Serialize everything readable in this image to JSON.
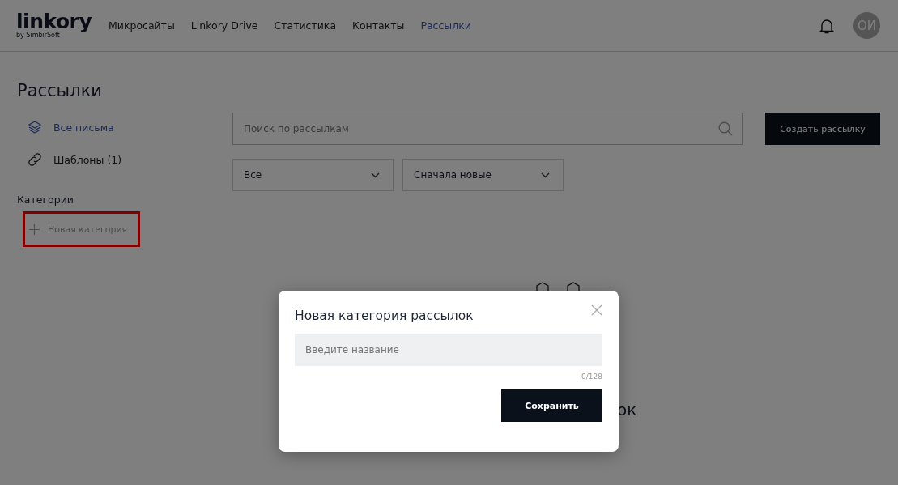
{
  "header": {
    "logo": {
      "name": "linkory",
      "tagline": "by SimbirSoft"
    },
    "nav": [
      {
        "label": "Микросайты",
        "selected": false
      },
      {
        "label": "Linkory Drive",
        "selected": false
      },
      {
        "label": "Статистика",
        "selected": false
      },
      {
        "label": "Контакты",
        "selected": false
      },
      {
        "label": "Рассылки",
        "selected": true
      }
    ],
    "avatar": "ОИ"
  },
  "page_title": "Рассылки",
  "sidebar": {
    "items": [
      {
        "label": "Все письма",
        "kind": "layers",
        "selected": true
      },
      {
        "label": "Шаблоны (1)",
        "kind": "link",
        "selected": false
      }
    ],
    "categories_heading": "Категории",
    "new_category": {
      "label": "Новая категория",
      "highlighted": true
    }
  },
  "search": {
    "placeholder": "Поиск по рассылкам"
  },
  "create_button": "Создать рассылку",
  "filters": [
    {
      "value": "Все"
    },
    {
      "value": "Сначала новые"
    }
  ],
  "empty_state": {
    "title_visible_part": "ок"
  },
  "dialog": {
    "title": "Новая категория рассылок",
    "input": {
      "placeholder": "Введите название"
    },
    "counter": "0/128",
    "save_button": "Сохранить"
  }
}
